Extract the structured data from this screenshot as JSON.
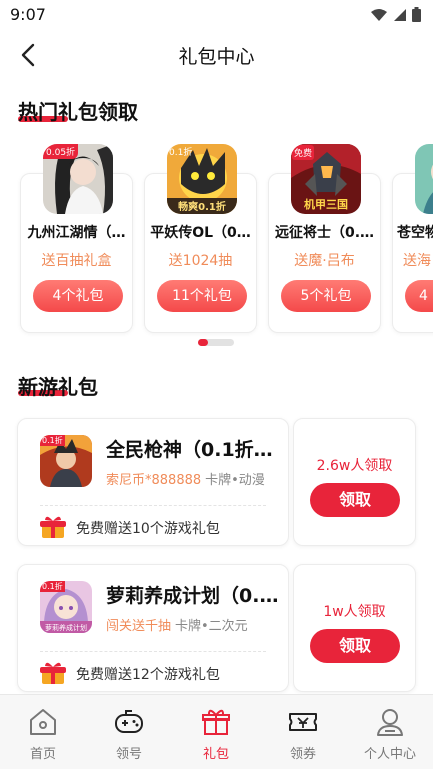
{
  "status_bar": {
    "time": "9:07"
  },
  "nav": {
    "title": "礼包中心"
  },
  "hot_section": {
    "title": "热门礼包领取",
    "cards": [
      {
        "name": "九州江湖情（…",
        "subtitle": "送百抽礼盒",
        "button": "4个礼包",
        "icon_badge": "0.05折",
        "icon": "game-icon-jiuzhou"
      },
      {
        "name": "平妖传OL（0…",
        "subtitle": "送1024抽",
        "button": "11个礼包",
        "icon_badge": "0.1折",
        "icon_caption": "畅爽0.1折",
        "icon": "game-icon-pingyao"
      },
      {
        "name": "远征将士（0.…",
        "subtitle": "送魔·吕布",
        "button": "5个礼包",
        "icon_badge": "免费",
        "icon_caption": "机甲三国",
        "icon": "game-icon-yuanzheng"
      },
      {
        "name": "苍空物",
        "subtitle": "送海",
        "button": "4",
        "icon": "game-icon-cangkong"
      }
    ],
    "carousel_page": 1
  },
  "new_section": {
    "title": "新游礼包",
    "games": [
      {
        "name": "全民枪神（0.1折…",
        "highlight": "索尼币*888888",
        "tags": "卡牌•动漫",
        "gifts_text": "免费赠送10个游戏礼包",
        "claimed": "2.6w人领取",
        "button": "领取",
        "icon": "game-icon-quanmin",
        "icon_badge": "0.1折"
      },
      {
        "name": "萝莉养成计划（0.…",
        "highlight": "闯关送千抽",
        "tags": "卡牌•二次元",
        "gifts_text": "免费赠送12个游戏礼包",
        "claimed": "1w人领取",
        "button": "领取",
        "icon": "game-icon-luoli",
        "icon_badge": "0.1折",
        "icon_caption": "萝莉养成计划"
      }
    ]
  },
  "tab_bar": {
    "active": "礼包",
    "tabs": [
      {
        "label": "首页",
        "icon": "home-icon"
      },
      {
        "label": "领号",
        "icon": "gamepad-icon"
      },
      {
        "label": "礼包",
        "icon": "gift-icon"
      },
      {
        "label": "领券",
        "icon": "coupon-icon"
      },
      {
        "label": "个人中心",
        "icon": "user-icon"
      }
    ]
  },
  "colors": {
    "accent": "#e8243a",
    "orange": "#f08c5a"
  }
}
